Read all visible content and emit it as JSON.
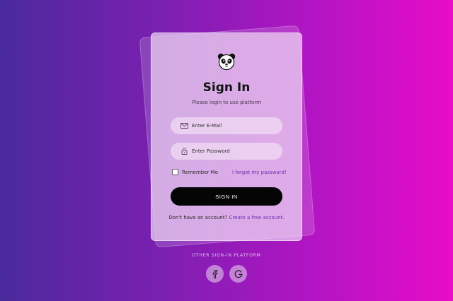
{
  "form": {
    "title": "Sign In",
    "subtitle": "Please login to use platform",
    "email_placeholder": "Enter E-Mail",
    "password_placeholder": "Enter Password",
    "remember_label": "Remember Me",
    "remember_checked": false,
    "forgot_link": "I forgot my password!",
    "signin_button": "SIGN IN",
    "no_account_text": "Don't have an account?",
    "create_account_link": "Create a free account."
  },
  "social": {
    "label": "OTHER SIGN-IN PLATFORM",
    "buttons": [
      {
        "icon": "facebook-icon"
      },
      {
        "icon": "google-icon"
      }
    ]
  },
  "icons": {
    "logo": "panda-logo-icon",
    "email": "mail-icon",
    "password": "lock-icon"
  },
  "colors": {
    "gradient_start": "#4a2a9c",
    "gradient_end": "#e80cc8",
    "button": "#050505",
    "link": "#6a2fb5"
  }
}
